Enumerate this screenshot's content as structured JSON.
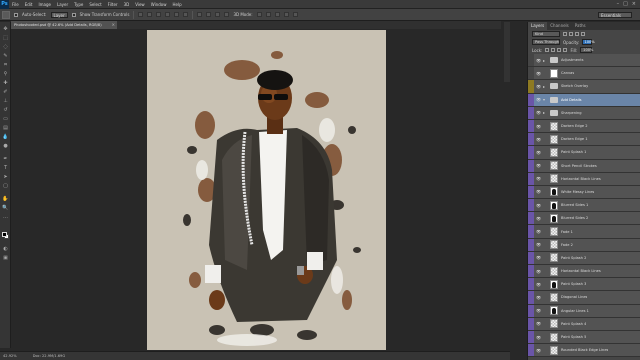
{
  "menubar": {
    "app_icon": "Ps",
    "items": [
      "File",
      "Edit",
      "Image",
      "Layer",
      "Type",
      "Select",
      "Filter",
      "3D",
      "View",
      "Window",
      "Help"
    ],
    "controls": [
      "–",
      "□",
      "×"
    ]
  },
  "options": {
    "auto_select_label": "Auto-Select:",
    "auto_select_value": "Layer",
    "transform_label": "Show Transform Controls",
    "mode_label": "3D Mode:",
    "workspace": "Essentials"
  },
  "document": {
    "tab_title": "Photoshooted.psd @ 42.6% (Add Details, RGB/8)",
    "close_icon": "×"
  },
  "status": {
    "zoom": "42.92%",
    "doc_size": "Doc: 22.9M/1.69G"
  },
  "panel": {
    "tabs": [
      "Layers",
      "Channels",
      "Paths"
    ],
    "kind_label": "Kind",
    "blend_mode": "Pass Through",
    "opacity_label": "Opacity:",
    "opacity_value": "100%",
    "lock_label": "Lock:",
    "fill_label": "Fill:",
    "fill_value": "100%"
  },
  "layers": [
    {
      "name": "Adjustments",
      "thumb": "folder",
      "vis": "none",
      "twirl": "▸"
    },
    {
      "name": "Canvas",
      "thumb": "white",
      "vis": "none",
      "twirl": ""
    },
    {
      "name": "Sketch Overlay",
      "thumb": "folder",
      "vis": "yellow",
      "twirl": "▸"
    },
    {
      "name": "Add Details",
      "thumb": "folder",
      "vis": "purple",
      "twirl": "▾",
      "selected": true
    },
    {
      "name": "Sharpening",
      "thumb": "folder",
      "vis": "purple",
      "twirl": "▸"
    },
    {
      "name": "Darken Edge 2",
      "thumb": "checker",
      "vis": "purple",
      "twirl": ""
    },
    {
      "name": "Darken Edge 1",
      "thumb": "checker",
      "vis": "purple",
      "twirl": ""
    },
    {
      "name": "Paint Splash 1",
      "thumb": "checker",
      "vis": "purple",
      "twirl": ""
    },
    {
      "name": "Short Pencil Strokes",
      "thumb": "checker",
      "vis": "purple",
      "twirl": ""
    },
    {
      "name": "Horizontal Black Lines",
      "thumb": "checker",
      "vis": "purple",
      "twirl": ""
    },
    {
      "name": "White Messy Lines",
      "thumb": "mask",
      "vis": "purple",
      "twirl": ""
    },
    {
      "name": "Blurred Sides 1",
      "thumb": "mask",
      "vis": "purple",
      "twirl": ""
    },
    {
      "name": "Blurred Sides 2",
      "thumb": "mask",
      "vis": "purple",
      "twirl": ""
    },
    {
      "name": "Fade 1",
      "thumb": "checker",
      "vis": "purple",
      "twirl": ""
    },
    {
      "name": "Fade 2",
      "thumb": "checker",
      "vis": "purple",
      "twirl": ""
    },
    {
      "name": "Paint Splash 2",
      "thumb": "checker",
      "vis": "purple",
      "twirl": ""
    },
    {
      "name": "Horizontal Black Lines",
      "thumb": "checker",
      "vis": "purple",
      "twirl": ""
    },
    {
      "name": "Paint Splash 3",
      "thumb": "mask",
      "vis": "purple",
      "twirl": ""
    },
    {
      "name": "Diagonal Lines",
      "thumb": "checker",
      "vis": "purple",
      "twirl": ""
    },
    {
      "name": "Angular Lines 1",
      "thumb": "mask",
      "vis": "purple",
      "twirl": ""
    },
    {
      "name": "Paint Splash 4",
      "thumb": "checker",
      "vis": "purple",
      "twirl": ""
    },
    {
      "name": "Paint Splash 5",
      "thumb": "checker",
      "vis": "purple",
      "twirl": ""
    },
    {
      "name": "Rounded Black Edge Lines",
      "thumb": "checker",
      "vis": "purple",
      "twirl": ""
    }
  ],
  "colors": {
    "selected_row": "#6a85a8",
    "group_color_purple": "#6a55a8",
    "group_color_yellow": "#8e7a22",
    "canvas_bg": "#c9c2b4"
  }
}
